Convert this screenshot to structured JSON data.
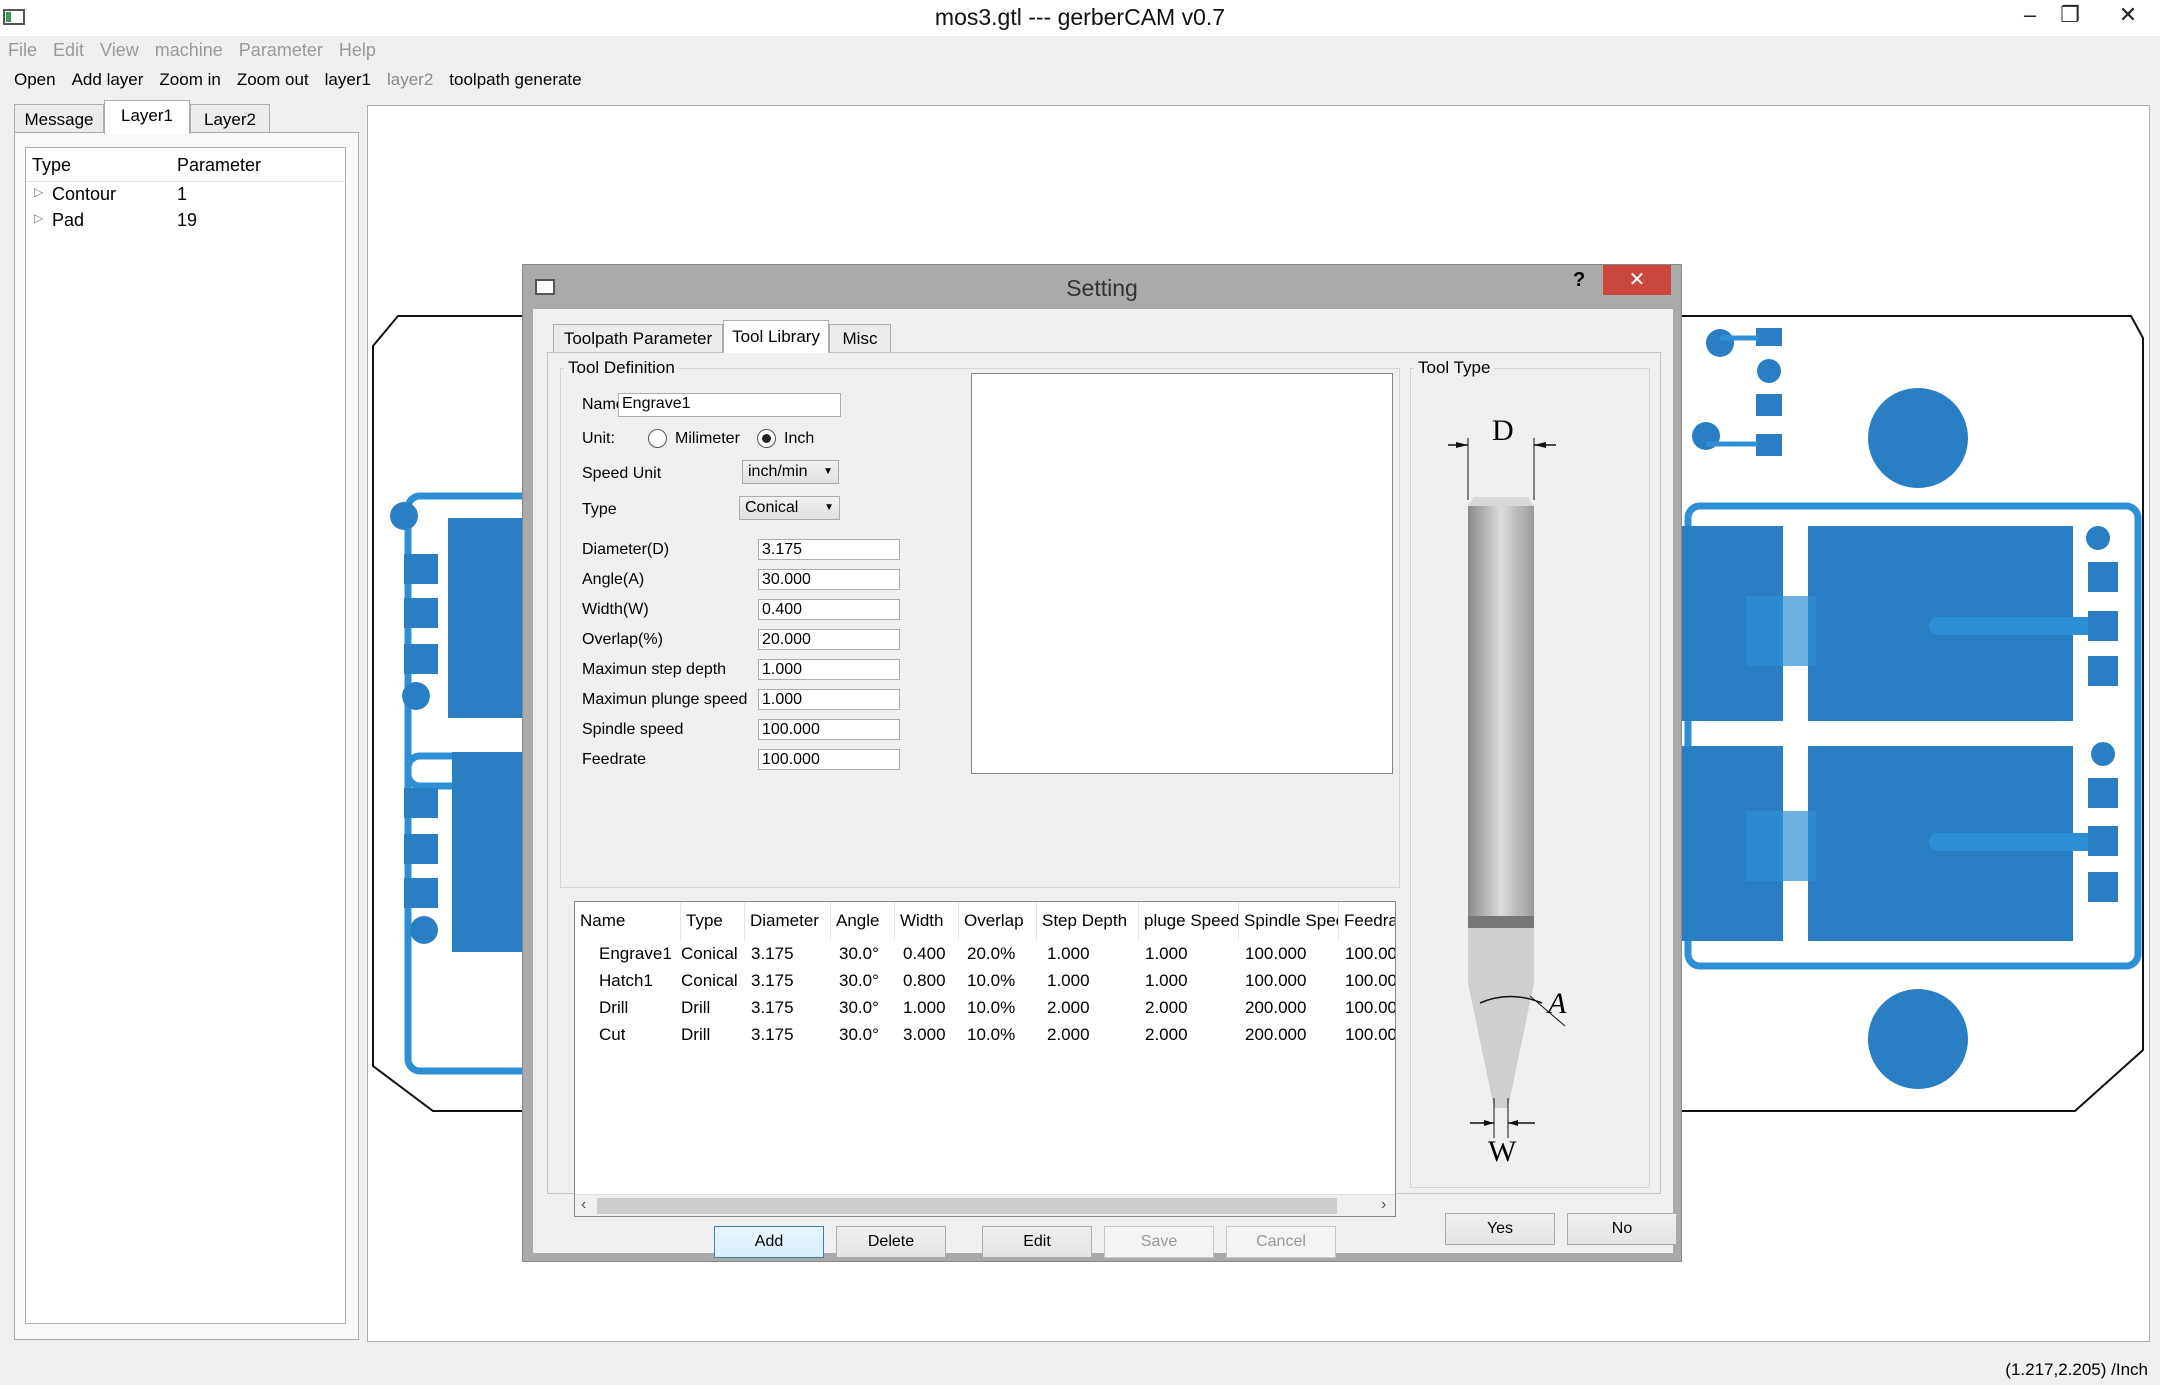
{
  "window": {
    "title": "mos3.gtl --- gerberCAM v0.7"
  },
  "menu": [
    "File",
    "Edit",
    "View",
    "machine",
    "Parameter",
    "Help"
  ],
  "toolbar": [
    {
      "label": "Open",
      "enabled": true
    },
    {
      "label": "Add layer",
      "enabled": true
    },
    {
      "label": "Zoom in",
      "enabled": true
    },
    {
      "label": "Zoom out",
      "enabled": true
    },
    {
      "label": "layer1",
      "enabled": true
    },
    {
      "label": "layer2",
      "enabled": false
    },
    {
      "label": "toolpath generate",
      "enabled": true
    }
  ],
  "left_tabs": [
    "Message",
    "Layer1",
    "Layer2"
  ],
  "tree": {
    "headers": [
      "Type",
      "Parameter"
    ],
    "rows": [
      {
        "type": "Contour",
        "param": "1"
      },
      {
        "type": "Pad",
        "param": "19"
      }
    ]
  },
  "status": "(1.217,2.205) /Inch",
  "dialog": {
    "title": "Setting",
    "help": "?",
    "tabs": [
      "Toolpath Parameter",
      "Tool Library",
      "Misc"
    ],
    "tool_definition": "Tool Definition",
    "tool_type": "Tool Type",
    "name_label": "Name",
    "name_value": "Engrave1",
    "unit_label": "Unit:",
    "unit_mm": "Milimeter",
    "unit_inch": "Inch",
    "speed_unit_label": "Speed Unit",
    "speed_unit_value": "inch/min",
    "type_label": "Type",
    "type_value": "Conical",
    "fields": [
      {
        "label": "Diameter(D)",
        "value": "3.175"
      },
      {
        "label": "Angle(A)",
        "value": "30.000"
      },
      {
        "label": "Width(W)",
        "value": "0.400"
      },
      {
        "label": "Overlap(%)",
        "value": "20.000"
      },
      {
        "label": "Maximun step depth",
        "value": "1.000"
      },
      {
        "label": "Maximun plunge speed",
        "value": "1.000"
      },
      {
        "label": "Spindle speed",
        "value": "100.000"
      },
      {
        "label": "Feedrate",
        "value": "100.000"
      }
    ],
    "table": {
      "headers": [
        "Name",
        "Type",
        "Diameter",
        "Angle",
        "Width",
        "Overlap",
        "Step Depth",
        "pluge Speed",
        "Spindle Speed",
        "Feedrate"
      ],
      "rows": [
        [
          "Engrave1",
          "Conical",
          "3.175",
          "30.0°",
          "0.400",
          "20.0%",
          "1.000",
          "1.000",
          "100.000",
          "100.00"
        ],
        [
          "Hatch1",
          "Conical",
          "3.175",
          "30.0°",
          "0.800",
          "10.0%",
          "1.000",
          "1.000",
          "100.000",
          "100.00"
        ],
        [
          "Drill",
          "Drill",
          "3.175",
          "30.0°",
          "1.000",
          "10.0%",
          "2.000",
          "2.000",
          "200.000",
          "100.00"
        ],
        [
          "Cut",
          "Drill",
          "3.175",
          "30.0°",
          "3.000",
          "10.0%",
          "2.000",
          "2.000",
          "200.000",
          "100.00"
        ]
      ]
    },
    "buttons": {
      "add": "Add",
      "delete": "Delete",
      "edit": "Edit",
      "save": "Save",
      "cancel": "Cancel",
      "yes": "Yes",
      "no": "No"
    },
    "diagram_labels": {
      "d": "D",
      "a": "A",
      "w": "W"
    }
  },
  "colors": {
    "pcb": "#2a7fc4",
    "pcb_trace": "#2f8fd6",
    "close_button": "#c9473d"
  }
}
